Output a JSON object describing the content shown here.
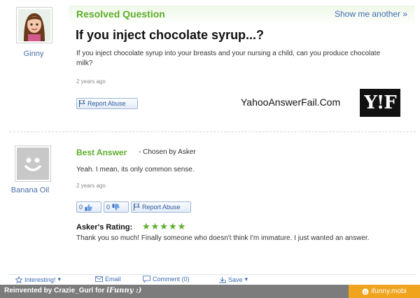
{
  "question": {
    "header": "Resolved Question",
    "show_another": "Show me another »",
    "title": "If you inject chocolate syrup...?",
    "body": "If you inject chocolate syrup into your breasts and your nursing a child, can you produce chocolate milk?",
    "time_ago": "2 years ago",
    "report_label": "Report Abuse",
    "asker": "Ginny"
  },
  "watermark": {
    "site": "YahooAnswerFail.Com",
    "logo": "Y!F"
  },
  "answer": {
    "header": "Best Answer",
    "chosen_by": "- Chosen by Asker",
    "body": "Yeah. I mean, its only common sense.",
    "time_ago": "2 years ago",
    "thumbs_up": "0",
    "thumbs_down": "0",
    "report_label": "Report Abuse",
    "answerer": "Banana Oil",
    "rating_label": "Asker's Rating:",
    "rating_stars": "★★★★★",
    "rating_value": 5,
    "rating_comment": "Thank you so much! Finally someone who doesn't think I'm immature. I just wanted an answer."
  },
  "actions": {
    "interesting": "Interesting!",
    "email": "Email",
    "comment": "Comment (0)",
    "save": "Save"
  },
  "footer": {
    "credit_prefix": "Reinvented by Crazie_Gurl for",
    "brand": "iFunny :)",
    "site": "ifunny.mobi"
  },
  "colors": {
    "accent_green": "#5cad2a",
    "link_blue": "#3d6cb3",
    "footer_gray": "#7c7c7c",
    "footer_orange": "#f0a31c"
  },
  "icons": [
    "ginny-avatar",
    "flag-icon",
    "thumbs-up-icon",
    "thumbs-down-icon",
    "default-avatar-icon",
    "star-icon",
    "email-icon",
    "comment-icon",
    "save-icon",
    "ifunny-icon"
  ]
}
